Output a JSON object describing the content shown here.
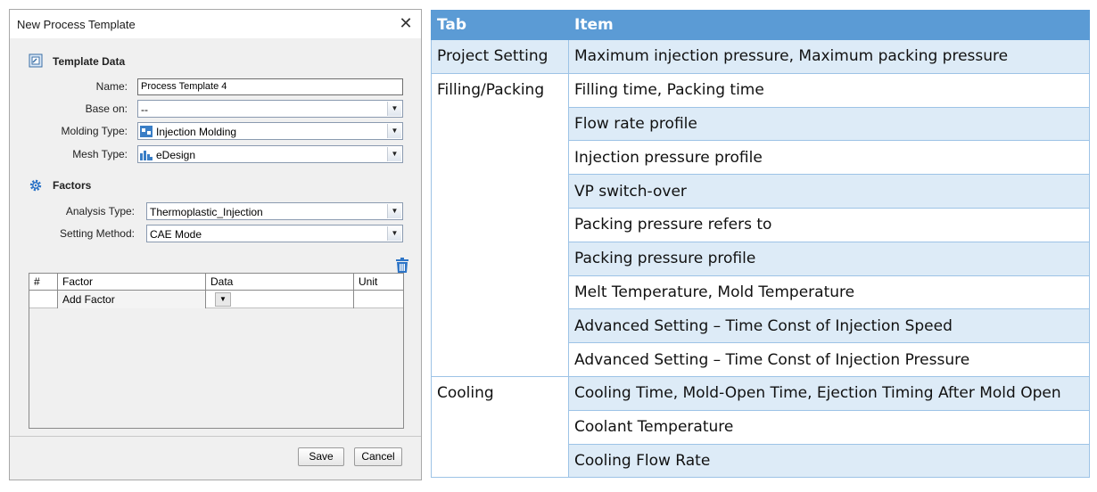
{
  "dialog": {
    "title": "New Process Template",
    "close_symbol": "✕",
    "template_data": {
      "heading": "Template Data",
      "name_label": "Name:",
      "name_value": "Process Template 4",
      "base_on_label": "Base on:",
      "base_on_value": "--",
      "molding_type_label": "Molding Type:",
      "molding_type_value": "Injection Molding",
      "mesh_type_label": "Mesh Type:",
      "mesh_type_value": "eDesign"
    },
    "factors": {
      "heading": "Factors",
      "analysis_type_label": "Analysis Type:",
      "analysis_type_value": "Thermoplastic_Injection",
      "setting_method_label": "Setting Method:",
      "setting_method_value": "CAE Mode"
    },
    "factor_table": {
      "columns": [
        "#",
        "Factor",
        "Data",
        "Unit"
      ],
      "add_factor_label": "Add Factor"
    },
    "buttons": {
      "save": "Save",
      "cancel": "Cancel"
    },
    "colors": {
      "accent_icon": "#3a7ec6"
    }
  },
  "table": {
    "headers": {
      "tab": "Tab",
      "item": "Item"
    },
    "groups": [
      {
        "tab": "Project Setting",
        "items": [
          "Maximum injection pressure, Maximum packing pressure"
        ]
      },
      {
        "tab": "Filling/Packing",
        "items": [
          "Filling time, Packing time",
          "Flow rate profile",
          "Injection pressure profile",
          "VP switch-over",
          "Packing pressure refers to",
          "Packing pressure profile",
          "Melt Temperature, Mold Temperature",
          "Advanced Setting – Time Const of Injection Speed",
          "Advanced Setting – Time Const of Injection Pressure"
        ]
      },
      {
        "tab": "Cooling",
        "items": [
          "Cooling Time, Mold-Open Time, Ejection Timing After Mold Open",
          "Coolant Temperature",
          "Cooling Flow Rate"
        ]
      }
    ],
    "colors": {
      "header": "#5b9bd5",
      "shade": "#ddebf7",
      "border": "#9dc3e6"
    }
  }
}
